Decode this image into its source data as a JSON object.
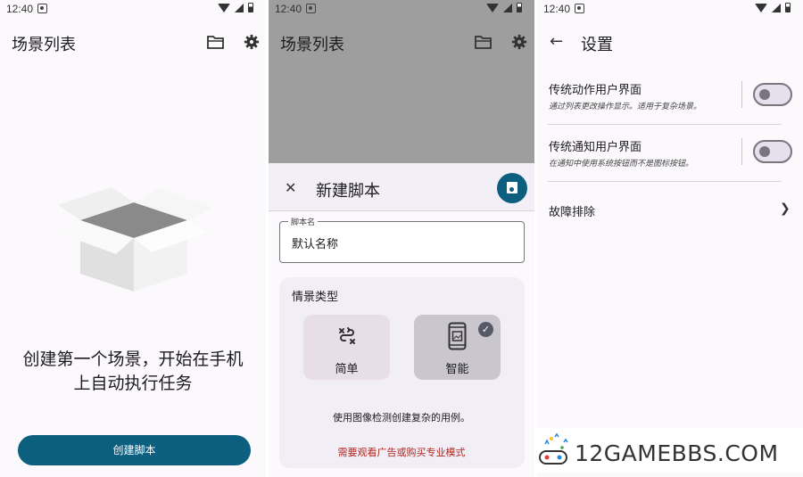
{
  "status": {
    "time": "12:40"
  },
  "screen1": {
    "title": "场景列表",
    "empty_line1": "创建第一个场景，开始在手机",
    "empty_line2": "上自动执行任务",
    "create_button": "创建脚本"
  },
  "screen2": {
    "title": "场景列表",
    "sheet_title": "新建脚本",
    "field_label": "脚本名",
    "field_value": "默认名称",
    "type_label": "情景类型",
    "options": [
      {
        "label": "简单",
        "selected": false
      },
      {
        "label": "智能",
        "selected": true
      }
    ],
    "description": "使用图像检测创建复杂的用例。",
    "warning": "需要观看广告或购买专业模式"
  },
  "screen3": {
    "title": "设置",
    "rows": [
      {
        "title": "传统动作用户界面",
        "subtitle": "通过列表更改操作显示。适用于复杂场景。"
      },
      {
        "title": "传统通知用户界面",
        "subtitle": "在通知中使用系统按钮而不是图标按钮。"
      },
      {
        "title": "故障排除"
      }
    ]
  },
  "watermark": {
    "text": "12GAMEBBS.COM"
  },
  "colors": {
    "primary": "#0d5f80",
    "warning": "#b3261e"
  }
}
